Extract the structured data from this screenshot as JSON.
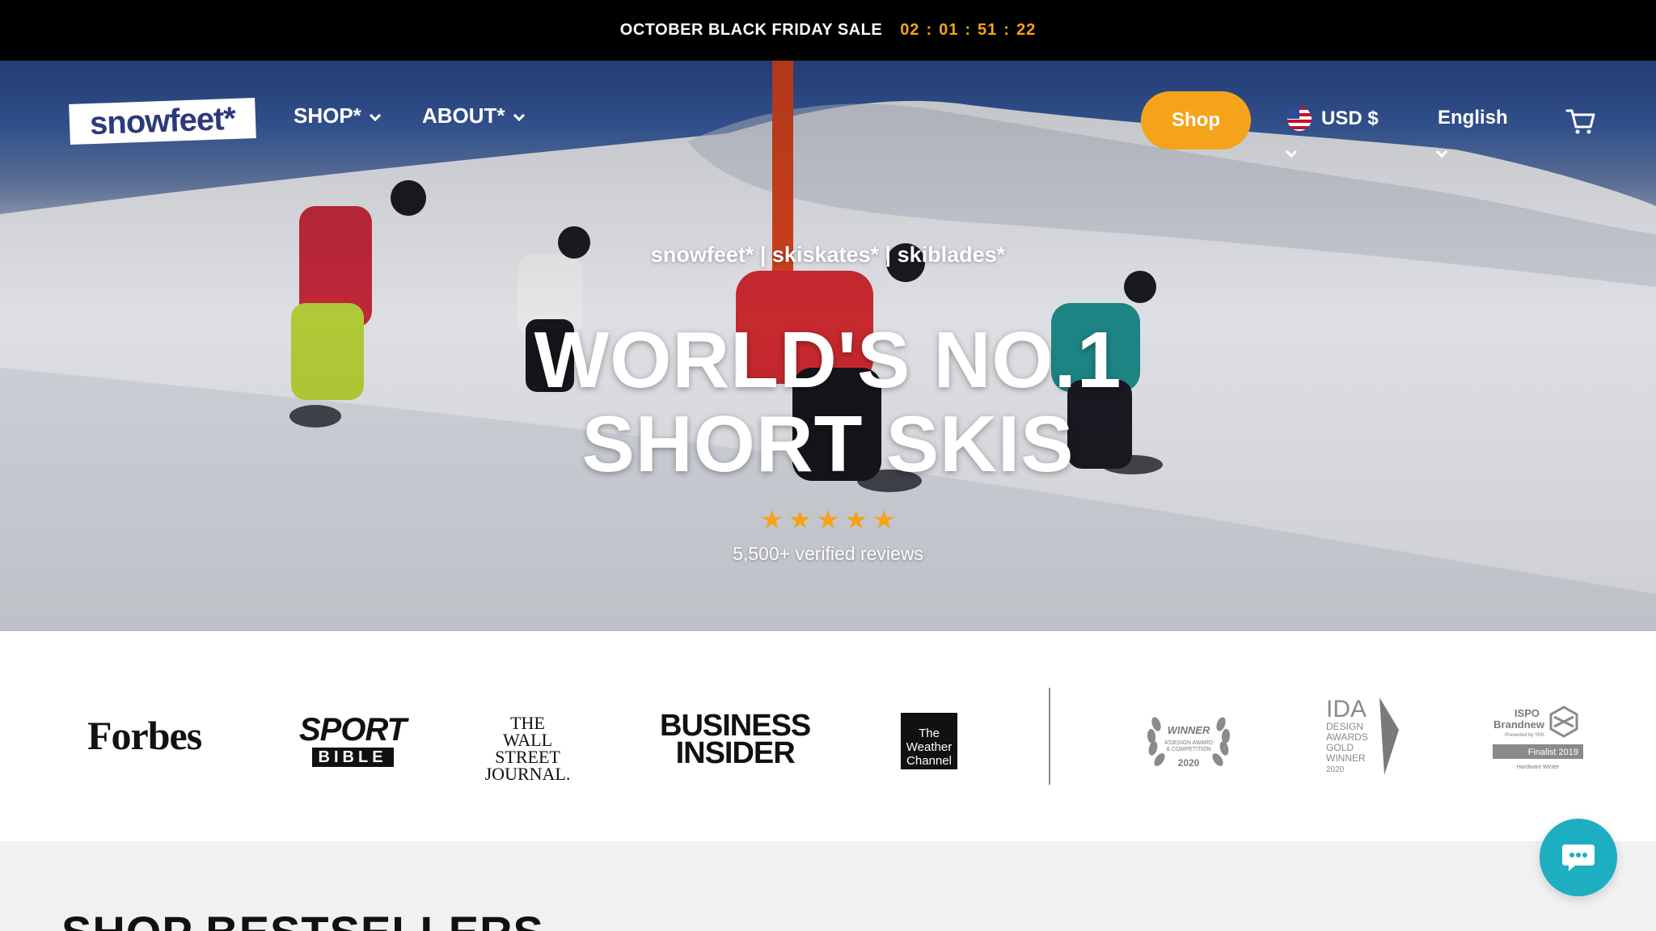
{
  "announcement": {
    "sale_text": "OCTOBER BLACK FRIDAY SALE",
    "countdown": [
      "02",
      ":",
      "01",
      ":",
      "51",
      ":",
      "22"
    ]
  },
  "header": {
    "logo_text": "snowfeet*",
    "nav": [
      {
        "label": "SHOP*"
      },
      {
        "label": "ABOUT*"
      }
    ],
    "shop_button": "Shop",
    "currency": "USD $",
    "language": "English",
    "cart_icon": "cart-icon"
  },
  "hero": {
    "tagline": "snowfeet* | skiskates* | skiblades*",
    "headline_line1": "WORLD'S NO.1",
    "headline_line2": "SHORT SKIS",
    "rating_stars": 5,
    "reviews": "5,500+ verified reviews"
  },
  "press": {
    "logos": [
      {
        "name": "Forbes"
      },
      {
        "name": "SPORT",
        "sub": "BIBLE"
      },
      {
        "lines": [
          "THE",
          "WALL STREET",
          "JOURNAL."
        ]
      },
      {
        "lines": [
          "BUSINESS",
          "INSIDER"
        ]
      },
      {
        "lines": [
          "The",
          "Weather",
          "Channel"
        ]
      }
    ],
    "awards": [
      {
        "lines": [
          "WINNER",
          "A'DESIGN AWARD",
          "& COMPETITION",
          "2020"
        ]
      },
      {
        "lines": [
          "IDA",
          "DESIGN",
          "AWARDS",
          "GOLD",
          "WINNER",
          "2020"
        ]
      },
      {
        "lines": [
          "ISPO",
          "Brandnew",
          "Presented by YKK",
          "Finalist 2019",
          "Hardware Winter"
        ]
      }
    ]
  },
  "bestsellers": {
    "title": "SHOP BESTSELLERS"
  },
  "colors": {
    "accent": "#f5a31a",
    "brand_navy": "#2c3a7c",
    "chat": "#1eaec2"
  },
  "chat_icon": "chat-bubble-icon"
}
